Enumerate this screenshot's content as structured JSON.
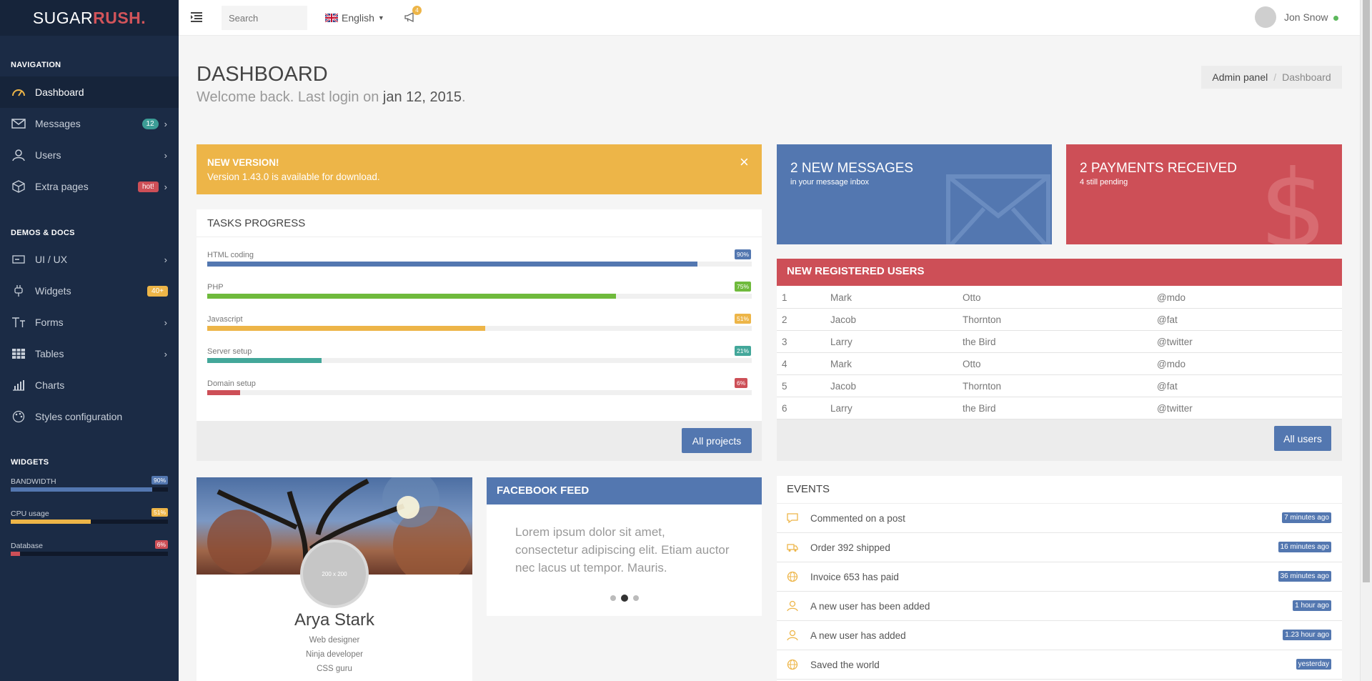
{
  "brand": {
    "part1": "SUGAR",
    "part2": "RUSH."
  },
  "sidebar": {
    "nav_title": "NAVIGATION",
    "nav": [
      {
        "label": "Dashboard",
        "icon": "dashboard-icon"
      },
      {
        "label": "Messages",
        "icon": "envelope-icon",
        "badge": "12"
      },
      {
        "label": "Users",
        "icon": "user-icon"
      },
      {
        "label": "Extra pages",
        "icon": "cube-icon",
        "badge": "hot!"
      }
    ],
    "demos_title": "DEMOS & DOCS",
    "demos": [
      {
        "label": "UI / UX",
        "icon": "ui-icon"
      },
      {
        "label": "Widgets",
        "icon": "plug-icon",
        "badge": "40+"
      },
      {
        "label": "Forms",
        "icon": "text-height-icon"
      },
      {
        "label": "Tables",
        "icon": "grid-icon"
      },
      {
        "label": "Charts",
        "icon": "chart-icon"
      },
      {
        "label": "Styles configuration",
        "icon": "palette-icon"
      }
    ],
    "widgets_title": "WIDGETS",
    "widgets": [
      {
        "label": "BANDWIDTH",
        "pct": "90%",
        "value": 90,
        "color": "#5377b0"
      },
      {
        "label": "CPU usage",
        "pct": "51%",
        "value": 51,
        "color": "#edb548"
      },
      {
        "label": "Database",
        "pct": "6%",
        "value": 6,
        "color": "#cd4f57"
      }
    ]
  },
  "topbar": {
    "search_placeholder": "Search",
    "language": "English",
    "notif_count": "4",
    "user_name": "Jon Snow"
  },
  "header": {
    "title": "DASHBOARD",
    "welcome_prefix": "Welcome back. Last login on ",
    "welcome_date": "jan 12, 2015",
    "welcome_suffix": ".",
    "breadcrumb": [
      "Admin panel",
      "/",
      "Dashboard"
    ]
  },
  "alert": {
    "title": "NEW VERSION!",
    "text": "Version 1.43.0 is available for download."
  },
  "tasks": {
    "title": "TASKS PROGRESS",
    "items": [
      {
        "label": "HTML coding",
        "pct": "90%",
        "value": 90,
        "color": "#5377b0"
      },
      {
        "label": "PHP",
        "pct": "75%",
        "value": 75,
        "color": "#6fba3c"
      },
      {
        "label": "Javascript",
        "pct": "51%",
        "value": 51,
        "color": "#edb548"
      },
      {
        "label": "Server setup",
        "pct": "21%",
        "value": 21,
        "color": "#43a79a"
      },
      {
        "label": "Domain setup",
        "pct": "6%",
        "value": 6,
        "color": "#cd4f57"
      }
    ],
    "button": "All projects"
  },
  "stats": {
    "messages": {
      "title": "2 NEW MESSAGES",
      "sub": "in your message inbox"
    },
    "payments": {
      "title": "2 PAYMENTS RECEIVED",
      "sub": "4 still pending",
      "symbol": "$"
    }
  },
  "users": {
    "title": "NEW REGISTERED USERS",
    "rows": [
      [
        "1",
        "Mark",
        "Otto",
        "@mdo"
      ],
      [
        "2",
        "Jacob",
        "Thornton",
        "@fat"
      ],
      [
        "3",
        "Larry",
        "the Bird",
        "@twitter"
      ],
      [
        "4",
        "Mark",
        "Otto",
        "@mdo"
      ],
      [
        "5",
        "Jacob",
        "Thornton",
        "@fat"
      ],
      [
        "6",
        "Larry",
        "the Bird",
        "@twitter"
      ]
    ],
    "button": "All users"
  },
  "profile": {
    "avatar_text": "200 x 200",
    "name": "Arya Stark",
    "lines": [
      "Web designer",
      "Ninja developer",
      "CSS guru"
    ]
  },
  "facebook": {
    "title": "FACEBOOK FEED",
    "text": "Lorem ipsum dolor sit amet, consectetur adipiscing elit. Etiam auctor nec lacus ut tempor. Mauris."
  },
  "events": {
    "title": "EVENTS",
    "items": [
      {
        "text": "Commented on a post",
        "time": "7 minutes ago",
        "icon": "comment-icon"
      },
      {
        "text": "Order 392 shipped",
        "time": "16 minutes ago",
        "icon": "truck-icon"
      },
      {
        "text": "Invoice 653 has paid",
        "time": "36 minutes ago",
        "icon": "globe-icon"
      },
      {
        "text": "A new user has been added",
        "time": "1 hour ago",
        "icon": "user-icon"
      },
      {
        "text": "A new user has added",
        "time": "1.23 hour ago",
        "icon": "user-icon"
      },
      {
        "text": "Saved the world",
        "time": "yesterday",
        "icon": "globe-icon"
      }
    ]
  },
  "colors": {
    "accent": "#5377b0",
    "danger": "#cd4f57",
    "warning": "#edb548",
    "sidebar": "#1b2b45"
  }
}
